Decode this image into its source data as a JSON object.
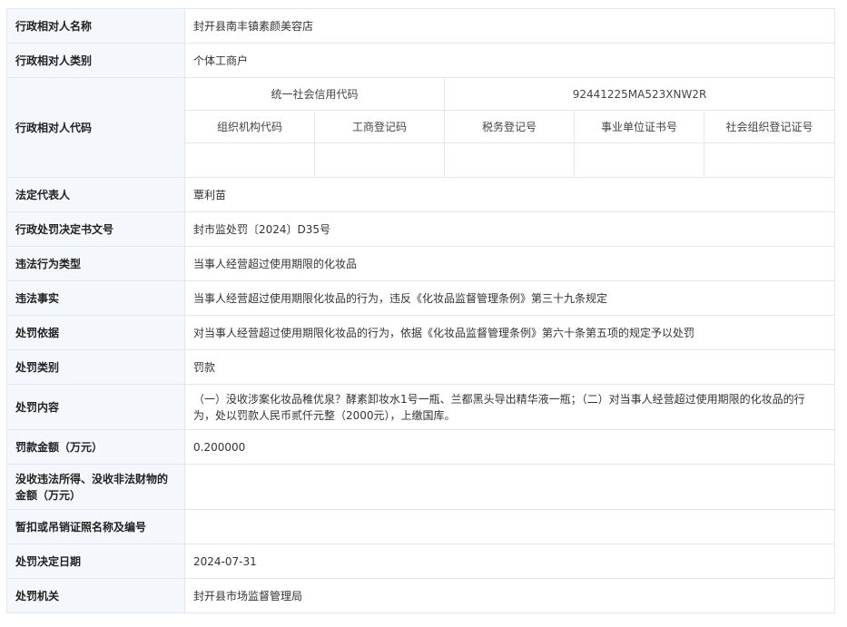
{
  "rows": {
    "name": {
      "label": "行政相对人名称",
      "value": "封开县南丰镇素颜美容店"
    },
    "category": {
      "label": "行政相对人类别",
      "value": "个体工商户"
    },
    "code": {
      "label": "行政相对人代码",
      "credit_code_label": "统一社会信用代码",
      "credit_code_value": "92441225MA523XNW2R",
      "sub_headers": [
        "组织机构代码",
        "工商登记码",
        "税务登记号",
        "事业单位证书号",
        "社会组织登记证号"
      ],
      "sub_values": [
        "",
        "",
        "",
        "",
        ""
      ]
    },
    "legal_rep": {
      "label": "法定代表人",
      "value": "覃利苗"
    },
    "decision_no": {
      "label": "行政处罚决定书文号",
      "value": "封市监处罚〔2024〕D35号"
    },
    "violation_type": {
      "label": "违法行为类型",
      "value": "当事人经营超过使用期限的化妆品"
    },
    "facts": {
      "label": "违法事实",
      "value": "当事人经营超过使用期限化妆品的行为，违反《化妆品监督管理条例》第三十九条规定"
    },
    "basis": {
      "label": "处罚依据",
      "value": "对当事人经营超过使用期限化妆品的行为，依据《化妆品监督管理条例》第六十条第五项的规定予以处罚"
    },
    "penalty_type": {
      "label": "处罚类别",
      "value": "罚款"
    },
    "content": {
      "label": "处罚内容",
      "value": "（一）没收涉案化妆品稚优泉？酵素卸妆水1号一瓶、兰都黑头导出精华液一瓶；（二）对当事人经营超过使用期限的化妆品的行为，处以罚款人民币贰仟元整（2000元），上缴国库。"
    },
    "fine": {
      "label": "罚款金额（万元）",
      "value": "0.200000"
    },
    "confiscation": {
      "label": "没收违法所得、没收非法财物的金额（万元）",
      "value": ""
    },
    "license": {
      "label": "暂扣或吊销证照名称及编号",
      "value": ""
    },
    "date": {
      "label": "处罚决定日期",
      "value": "2024-07-31"
    },
    "authority": {
      "label": "处罚机关",
      "value": "封开县市场监督管理局"
    }
  }
}
